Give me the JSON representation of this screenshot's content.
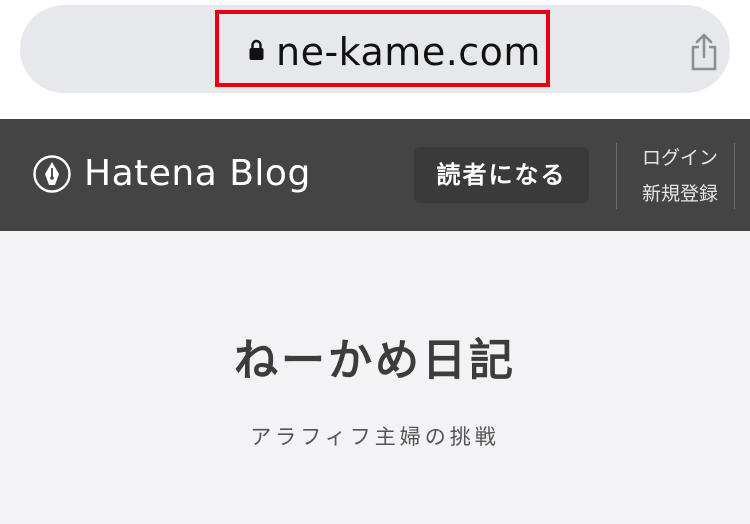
{
  "browser": {
    "url": "ne-kame.com",
    "lock_icon": "lock-icon",
    "share_icon": "share-icon",
    "highlight_color": "#e60012"
  },
  "blogbar": {
    "logo_icon": "hatena-pen-icon",
    "logo_text": "Hatena Blog",
    "subscribe_label": "読者になる",
    "login_label": "ログイン",
    "signup_label": "新規登録",
    "background": "#444444"
  },
  "blog": {
    "title": "ねーかめ日記",
    "description": "アラフィフ主婦の挑戦"
  }
}
